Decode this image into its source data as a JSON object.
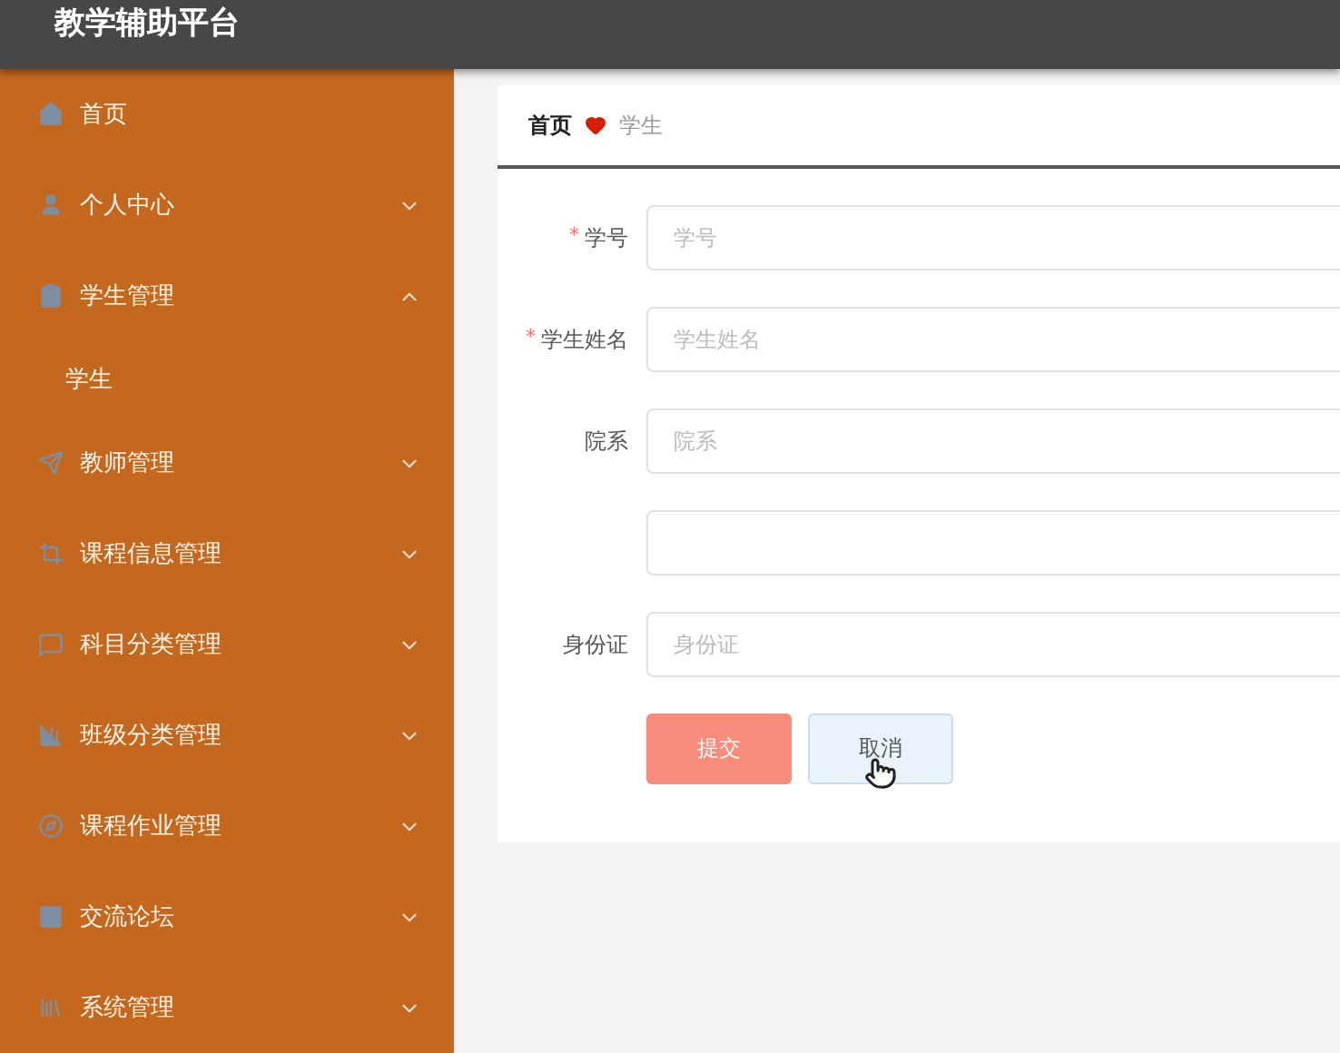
{
  "header": {
    "title": "教学辅助平台"
  },
  "sidebar": {
    "items": [
      {
        "label": "首页"
      },
      {
        "label": "个人中心",
        "expanded": false
      },
      {
        "label": "学生管理",
        "expanded": true,
        "children": [
          {
            "label": "学生"
          }
        ]
      },
      {
        "label": "教师管理",
        "expanded": false
      },
      {
        "label": "课程信息管理",
        "expanded": false
      },
      {
        "label": "科目分类管理",
        "expanded": false
      },
      {
        "label": "班级分类管理",
        "expanded": false
      },
      {
        "label": "课程作业管理",
        "expanded": false
      },
      {
        "label": "交流论坛",
        "expanded": false
      },
      {
        "label": "系统管理",
        "expanded": false
      }
    ]
  },
  "breadcrumb": [
    "首页",
    "学生"
  ],
  "form": {
    "fields": [
      {
        "kind": "text",
        "required_mark": "*",
        "label": "学号",
        "placeholder": "学号"
      },
      {
        "kind": "text",
        "required_mark": "*",
        "label": "学生姓名",
        "placeholder": "学生姓名"
      },
      {
        "kind": "text",
        "label": "院系",
        "placeholder": "院系"
      },
      {
        "kind": "text"
      },
      {
        "kind": "text",
        "label": "身份证",
        "placeholder": "身份证"
      }
    ],
    "buttons": [
      {
        "label": "提交",
        "kind": "primary"
      },
      {
        "label": "取消",
        "kind": "secondary"
      }
    ]
  }
}
